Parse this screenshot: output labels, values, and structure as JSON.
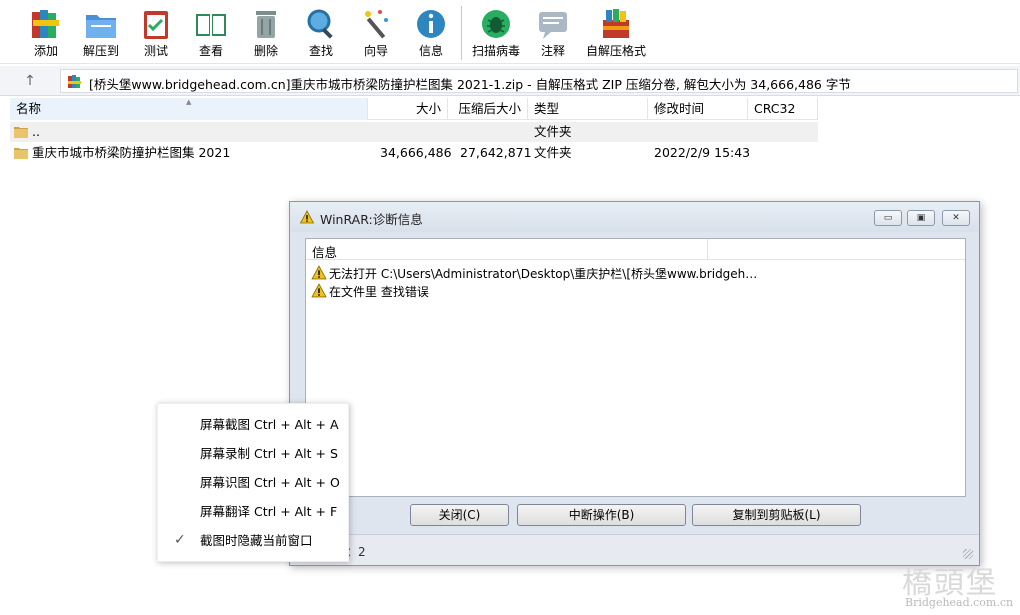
{
  "toolbar": {
    "buttons": [
      {
        "label": "添加",
        "icon": "books-add-icon"
      },
      {
        "label": "解压到",
        "icon": "folder-extract-icon"
      },
      {
        "label": "测试",
        "icon": "clipboard-test-icon"
      },
      {
        "label": "查看",
        "icon": "book-view-icon"
      },
      {
        "label": "删除",
        "icon": "trash-delete-icon"
      },
      {
        "label": "查找",
        "icon": "magnifier-find-icon"
      },
      {
        "label": "向导",
        "icon": "wand-wizard-icon"
      },
      {
        "label": "信息",
        "icon": "info-icon"
      },
      {
        "label": "扫描病毒",
        "icon": "bug-scan-icon"
      },
      {
        "label": "注释",
        "icon": "comment-icon"
      },
      {
        "label": "自解压格式",
        "icon": "sfx-box-icon"
      }
    ]
  },
  "address": {
    "text": "[桥头堡www.bridgehead.com.cn]重庆市城市桥梁防撞护栏图集 2021-1.zip - 自解压格式 ZIP 压缩分卷, 解包大小为 34,666,486 字节"
  },
  "filelist": {
    "columns": [
      "名称",
      "大小",
      "压缩后大小",
      "类型",
      "修改时间",
      "CRC32"
    ],
    "rows": [
      {
        "name": "..",
        "size": "",
        "packed": "",
        "type": "文件夹",
        "modified": "",
        "crc": ""
      },
      {
        "name": "重庆市城市桥梁防撞护栏图集 2021",
        "size": "34,666,486",
        "packed": "27,642,871",
        "type": "文件夹",
        "modified": "2022/2/9 15:43",
        "crc": ""
      }
    ]
  },
  "dialog": {
    "title": "WinRAR:诊断信息",
    "list_header": "信息",
    "messages": [
      "无法打开 C:\\Users\\Administrator\\Desktop\\重庆护栏\\[桥头堡www.bridgeh…",
      "在文件里 查找错误"
    ],
    "buttons": {
      "close": "关闭(C)",
      "abort": "中断操作(B)",
      "copy": "复制到剪贴板(L)"
    },
    "status": "错误总数：2"
  },
  "context_menu": {
    "items": [
      {
        "label": "屏幕截图 Ctrl + Alt + A",
        "checked": false
      },
      {
        "label": "屏幕录制 Ctrl + Alt + S",
        "checked": false
      },
      {
        "label": "屏幕识图 Ctrl + Alt + O",
        "checked": false
      },
      {
        "label": "屏幕翻译 Ctrl + Alt + F",
        "checked": false
      },
      {
        "label": "截图时隐藏当前窗口",
        "checked": true
      }
    ],
    "check_glyph": "✓"
  },
  "watermark": {
    "brand": "橋頭堡",
    "url": "Bridgehead.com.cn"
  },
  "colors": {
    "accent": "#3c7fd8",
    "warning": "#f0c020",
    "folder": "#e8b84a"
  }
}
